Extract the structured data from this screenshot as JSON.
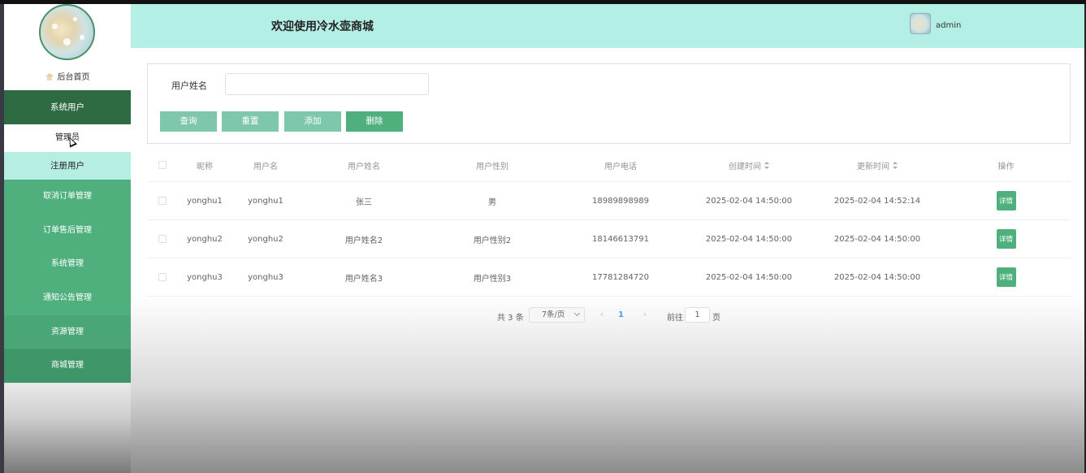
{
  "header": {
    "title": "欢迎使用冷水壶商城",
    "user_name": "admin"
  },
  "sidebar": {
    "home_label": "后台首页",
    "group_label": "系统用户",
    "sub_items": [
      {
        "label": "管理员"
      },
      {
        "label": "注册用户"
      }
    ],
    "items": [
      {
        "label": "取消订单管理"
      },
      {
        "label": "订单售后管理"
      },
      {
        "label": "系统管理"
      },
      {
        "label": "通知公告管理"
      },
      {
        "label": "资源管理"
      },
      {
        "label": "商城管理"
      }
    ]
  },
  "search": {
    "label": "用户姓名",
    "value": "",
    "buttons": {
      "query": "查询",
      "reset": "重置",
      "add": "添加",
      "delete": "删除"
    }
  },
  "table": {
    "columns": [
      "昵称",
      "用户名",
      "用户姓名",
      "用户性别",
      "用户电话",
      "创建时间",
      "更新时间",
      "操作"
    ],
    "rows": [
      {
        "nickname": "yonghu1",
        "username": "yonghu1",
        "name": "张三",
        "gender": "男",
        "phone": "18989898989",
        "created": "2025-02-04 14:50:00",
        "updated": "2025-02-04 14:52:14",
        "action": "详情"
      },
      {
        "nickname": "yonghu2",
        "username": "yonghu2",
        "name": "用户姓名2",
        "gender": "用户性别2",
        "phone": "18146613791",
        "created": "2025-02-04 14:50:00",
        "updated": "2025-02-04 14:50:00",
        "action": "详情"
      },
      {
        "nickname": "yonghu3",
        "username": "yonghu3",
        "name": "用户姓名3",
        "gender": "用户性别3",
        "phone": "17781284720",
        "created": "2025-02-04 14:50:00",
        "updated": "2025-02-04 14:50:00",
        "action": "详情"
      }
    ]
  },
  "pagination": {
    "total": "共 3 条",
    "page_size": "7条/页",
    "current_page": "1",
    "goto_prefix": "前往",
    "goto_value": "1",
    "goto_suffix": "页"
  },
  "colors": {
    "header_bg": "#b3efe5",
    "menu_group_bg": "#2f6b42",
    "menu_item_bg": "#4fb07e",
    "active_sub_bg": "#b7eee4",
    "button_light": "#7ec7ab",
    "button_primary": "#4fb07e",
    "pager_active": "#409eff"
  },
  "icons": {
    "home": "home-icon",
    "sort": "sort-icon",
    "caret": "chevron-down-icon",
    "prev": "chevron-left-icon",
    "next": "chevron-right-icon"
  }
}
